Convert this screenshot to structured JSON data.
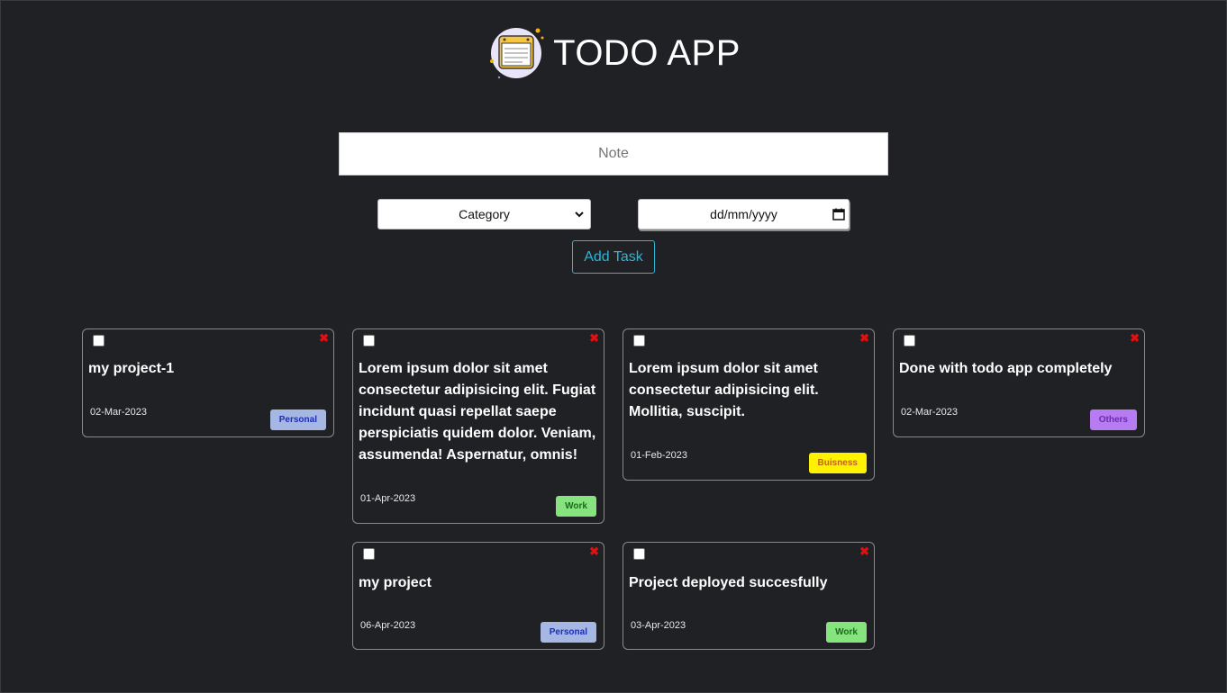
{
  "header": {
    "title": "TODO APP",
    "logo_icon": "notepad-icon"
  },
  "form": {
    "note_placeholder": "Note",
    "category_selected": "Category",
    "date_placeholder": "dd/mm/yyyy",
    "add_label": "Add Task"
  },
  "colors": {
    "background": "#202124",
    "accent": "#2bb5d8",
    "delete": "#e01010",
    "personal": "#a7b7e3",
    "work": "#86e47f",
    "business": "#fff200",
    "others": "#b77cf2"
  },
  "tasks": [
    {
      "text": "my project-1",
      "date": "02-Mar-2023",
      "category": "Personal"
    },
    {
      "text": "Lorem ipsum dolor sit amet consectetur adipisicing elit. Fugiat incidunt quasi repellat saepe perspiciatis quidem dolor. Veniam, assumenda! Aspernatur, omnis!",
      "date": "01-Apr-2023",
      "category": "Work"
    },
    {
      "text": "Lorem ipsum dolor sit amet consectetur adipisicing elit. Mollitia, suscipit.",
      "date": "01-Feb-2023",
      "category": "Buisness"
    },
    {
      "text": "Done with todo app completely",
      "date": "02-Mar-2023",
      "category": "Others"
    },
    {
      "text": "my project",
      "date": "06-Apr-2023",
      "category": "Personal"
    },
    {
      "text": "Project deployed succesfully",
      "date": "03-Apr-2023",
      "category": "Work"
    }
  ]
}
